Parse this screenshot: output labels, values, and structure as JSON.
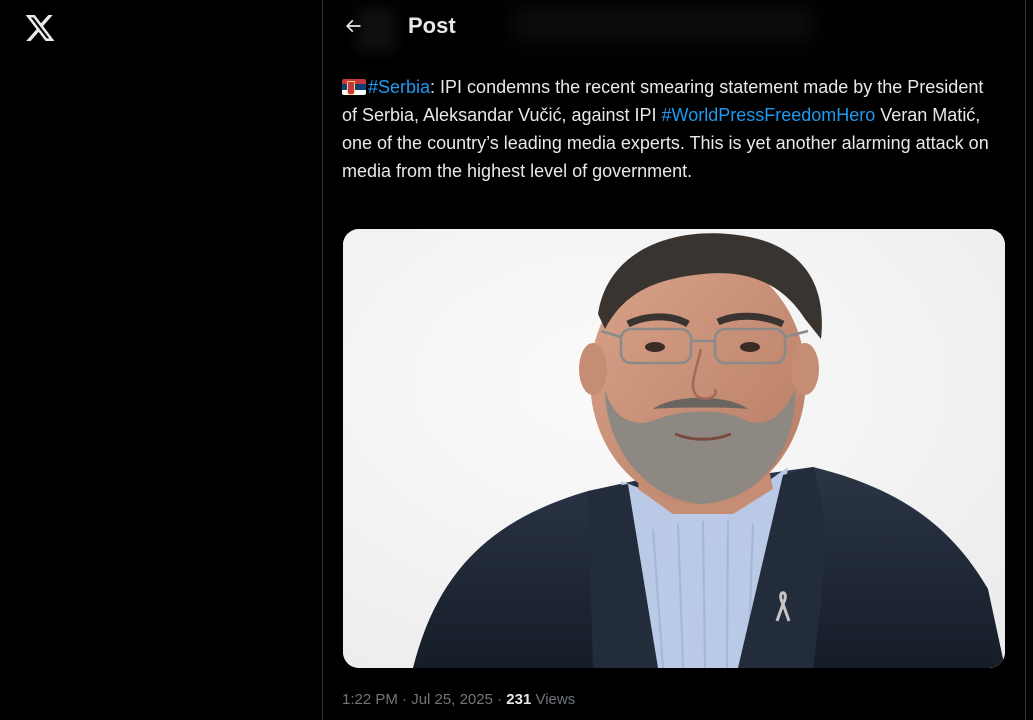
{
  "app": {
    "logo_icon": "x-logo-icon"
  },
  "header": {
    "title": "Post",
    "back_icon": "arrow-left-icon"
  },
  "tweet": {
    "flag": "serbia-flag-emoji",
    "hashtag_serbia": "#Serbia",
    "text_1": ": IPI condemns the recent smearing statement made by the President of Serbia, Aleksandar Vučić, against IPI ",
    "hashtag_hero": "#WorldPressFreedomHero",
    "text_2": " Veran Matić, one of the country’s leading media experts. This is yet another alarming attack on media from the highest level of government.",
    "hashtag_color": "#1d9bf0"
  },
  "photo": {
    "subject": "portrait-photo"
  },
  "meta": {
    "time": "1:22 PM",
    "separator_1": " · ",
    "date": "Jul 25, 2025",
    "separator_2": " · ",
    "views_count": "231",
    "views_label": " Views"
  }
}
